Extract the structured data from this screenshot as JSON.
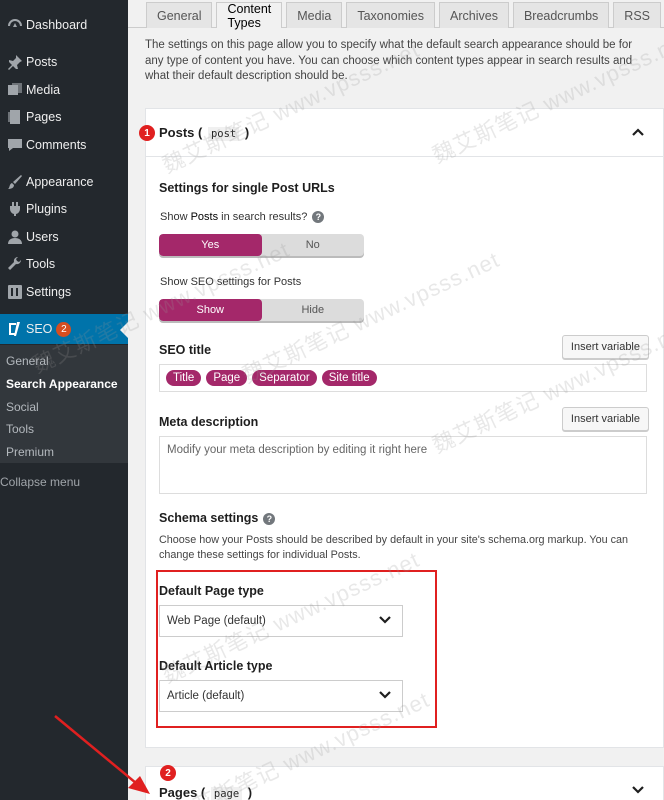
{
  "sidebar": {
    "items": [
      {
        "label": "Dashboard",
        "icon": "dashboard-icon"
      },
      {
        "label": "Posts",
        "icon": "pin-icon"
      },
      {
        "label": "Media",
        "icon": "media-icon"
      },
      {
        "label": "Pages",
        "icon": "page-icon"
      },
      {
        "label": "Comments",
        "icon": "comment-icon"
      },
      {
        "label": "Appearance",
        "icon": "brush-icon"
      },
      {
        "label": "Plugins",
        "icon": "plugin-icon"
      },
      {
        "label": "Users",
        "icon": "user-icon"
      },
      {
        "label": "Tools",
        "icon": "wrench-icon"
      },
      {
        "label": "Settings",
        "icon": "settings-icon"
      }
    ],
    "seo": {
      "label": "SEO",
      "badge": "2",
      "icon": "yoast-icon"
    },
    "submenu": [
      {
        "label": "General"
      },
      {
        "label": "Search Appearance",
        "active": true
      },
      {
        "label": "Social"
      },
      {
        "label": "Tools"
      },
      {
        "label": "Premium"
      }
    ],
    "collapse_label": "Collapse menu"
  },
  "tabs": [
    "General",
    "Content Types",
    "Media",
    "Taxonomies",
    "Archives",
    "Breadcrumbs",
    "RSS"
  ],
  "active_tab": "Content Types",
  "intro": "The settings on this page allow you to specify what the default search appearance should be for any type of content you have. You can choose which content types appear in search results and what their default description should be.",
  "posts_panel": {
    "marker": "1",
    "title": "Posts",
    "slug": "post",
    "section_title": "Settings for single Post URLs",
    "show_in_results_prefix": "Show ",
    "show_in_results_bold": "Posts",
    "show_in_results_suffix": " in search results?",
    "help_glyph": "?",
    "toggle1": {
      "on": "Yes",
      "off": "No"
    },
    "show_seo_label": "Show SEO settings for Posts",
    "toggle2": {
      "on": "Show",
      "off": "Hide"
    },
    "seo_title_label": "SEO title",
    "insert_variable": "Insert variable",
    "seo_title_pills": [
      "Title",
      "Page",
      "Separator",
      "Site title"
    ],
    "meta_label": "Meta description",
    "meta_placeholder": "Modify your meta description by editing it right here",
    "schema_label": "Schema settings",
    "schema_desc": "Choose how your Posts should be described by default in your site's schema.org markup. You can change these settings for individual Posts.",
    "default_page_type_label": "Default Page type",
    "default_page_type_value": "Web Page (default)",
    "default_article_type_label": "Default Article type",
    "default_article_type_value": "Article (default)"
  },
  "pages_panel": {
    "marker": "2",
    "title": "Pages",
    "slug": "page"
  },
  "watermark": "魏艾斯笔记 www.vpsss.net",
  "colors": {
    "accent": "#a4286a",
    "sidebar": "#23282d",
    "active_menu": "#0073aa",
    "annotation": "#e02020"
  }
}
